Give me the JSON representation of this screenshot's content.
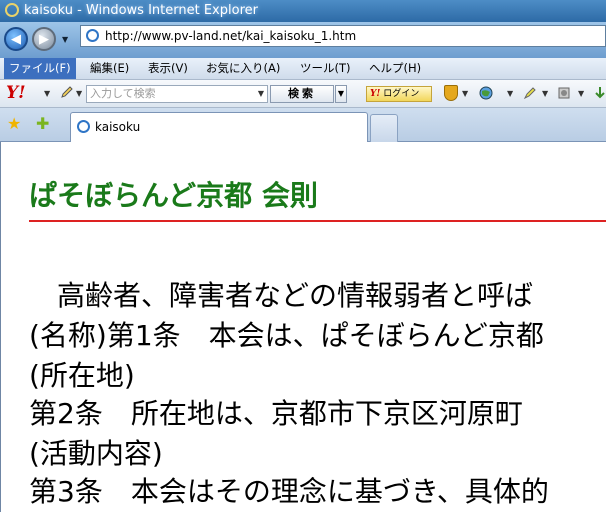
{
  "window": {
    "title": "kaisoku - Windows Internet Explorer"
  },
  "address_bar": {
    "url": "http://www.pv-land.net/kai_kaisoku_1.htm"
  },
  "menu": {
    "items": [
      {
        "label": "ファイル(F)",
        "active": true
      },
      {
        "label": "編集(E)"
      },
      {
        "label": "表示(V)"
      },
      {
        "label": "お気に入り(A)"
      },
      {
        "label": "ツール(T)"
      },
      {
        "label": "ヘルプ(H)"
      }
    ]
  },
  "yahoo_toolbar": {
    "logo": "Y!",
    "search_placeholder": "入力して検索",
    "search_button": "検索",
    "login_label": "ログイン",
    "login_logo": "Y!"
  },
  "tabs": [
    {
      "label": "kaisoku"
    }
  ],
  "page": {
    "heading": "ぱそぼらんど京都 会則",
    "lines": [
      "　高齢者、障害者などの情報弱者と呼ば",
      "(名称)第1条　本会は、ぱそぼらんど京都",
      "(所在地)",
      "第2条　所在地は、京都市下京区河原町",
      "(活動内容)",
      "第3条　本会はその理念に基づき、具体的"
    ]
  },
  "colors": {
    "heading": "#1a7a1a",
    "rule": "#dd2222",
    "menu_active": "#3c6fbf"
  }
}
